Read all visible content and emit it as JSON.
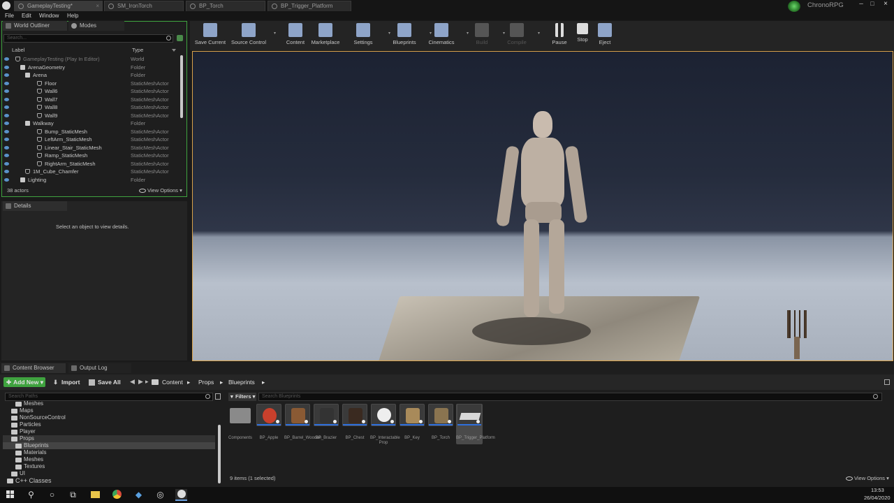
{
  "title_bar": {
    "tabs": [
      {
        "label": "GameplayTesting*"
      },
      {
        "label": "SM_IronTorch"
      },
      {
        "label": "BP_Torch"
      },
      {
        "label": "BP_Trigger_Platform"
      }
    ],
    "project_name": "ChronoRPG"
  },
  "menu": {
    "items": [
      "File",
      "Edit",
      "Window",
      "Help"
    ]
  },
  "outliner": {
    "tab_label": "World Outliner",
    "modes_label": "Modes",
    "search_placeholder": "Search...",
    "col_label": "Label",
    "col_type": "Type",
    "rows": [
      {
        "label": "GameplayTesting (Play In Editor)",
        "type": "World"
      },
      {
        "label": "ArenaGeometry",
        "type": "Folder"
      },
      {
        "label": "Arena",
        "type": "Folder"
      },
      {
        "label": "Floor",
        "type": "StaticMeshActor"
      },
      {
        "label": "Wall6",
        "type": "StaticMeshActor"
      },
      {
        "label": "Wall7",
        "type": "StaticMeshActor"
      },
      {
        "label": "Wall8",
        "type": "StaticMeshActor"
      },
      {
        "label": "Wall9",
        "type": "StaticMeshActor"
      },
      {
        "label": "Walkway",
        "type": "Folder"
      },
      {
        "label": "Bump_StaticMesh",
        "type": "StaticMeshActor"
      },
      {
        "label": "LeftArm_StaticMesh",
        "type": "StaticMeshActor"
      },
      {
        "label": "Linear_Stair_StaticMesh",
        "type": "StaticMeshActor"
      },
      {
        "label": "Ramp_StaticMesh",
        "type": "StaticMeshActor"
      },
      {
        "label": "RightArm_StaticMesh",
        "type": "StaticMeshActor"
      },
      {
        "label": "1M_Cube_Chamfer",
        "type": "StaticMeshActor"
      },
      {
        "label": "Lighting",
        "type": "Folder"
      }
    ],
    "actor_count": "38 actors",
    "view_options": "View Options"
  },
  "details": {
    "tab_label": "Details",
    "empty_text": "Select an object to view details."
  },
  "toolbar": {
    "buttons": [
      {
        "label": "Save Current"
      },
      {
        "label": "Source Control"
      },
      {
        "label": "Content"
      },
      {
        "label": "Marketplace"
      },
      {
        "label": "Settings"
      },
      {
        "label": "Blueprints"
      },
      {
        "label": "Cinematics"
      },
      {
        "label": "Build"
      },
      {
        "label": "Compile"
      },
      {
        "label": "Pause"
      },
      {
        "label": "Stop"
      },
      {
        "label": "Eject"
      }
    ]
  },
  "bottom_tabs": {
    "content_browser": "Content Browser",
    "output_log": "Output Log"
  },
  "content_browser": {
    "add_new": "Add New",
    "import": "Import",
    "save_all": "Save All",
    "breadcrumb": [
      "Content",
      "Props",
      "Blueprints"
    ],
    "search_paths_placeholder": "Search Paths",
    "filters_label": "Filters",
    "search_assets_placeholder": "Search Blueprints",
    "tree": [
      {
        "label": "Meshes"
      },
      {
        "label": "Maps"
      },
      {
        "label": "NonSourceControl"
      },
      {
        "label": "Particles"
      },
      {
        "label": "Player"
      },
      {
        "label": "Props"
      },
      {
        "label": "Blueprints"
      },
      {
        "label": "Materials"
      },
      {
        "label": "Meshes"
      },
      {
        "label": "Textures"
      },
      {
        "label": "UI"
      },
      {
        "label": "C++ Classes"
      }
    ],
    "assets": [
      {
        "label": "Components"
      },
      {
        "label": "BP_Apple"
      },
      {
        "label": "BP_Barrel_Wooden"
      },
      {
        "label": "BP_Brazier"
      },
      {
        "label": "BP_Chest"
      },
      {
        "label": "BP_Interactable Prop"
      },
      {
        "label": "BP_Key"
      },
      {
        "label": "BP_Torch"
      },
      {
        "label": "BP_Trigger_Platform"
      }
    ],
    "status": "9 items (1 selected)",
    "view_options": "View Options"
  },
  "taskbar": {
    "time": "13:53",
    "date": "26/04/2020"
  },
  "colors": {
    "accent_green": "#3fa33f",
    "viewport_border": "#d9a24a",
    "selection_blue": "#2f6fdb"
  }
}
